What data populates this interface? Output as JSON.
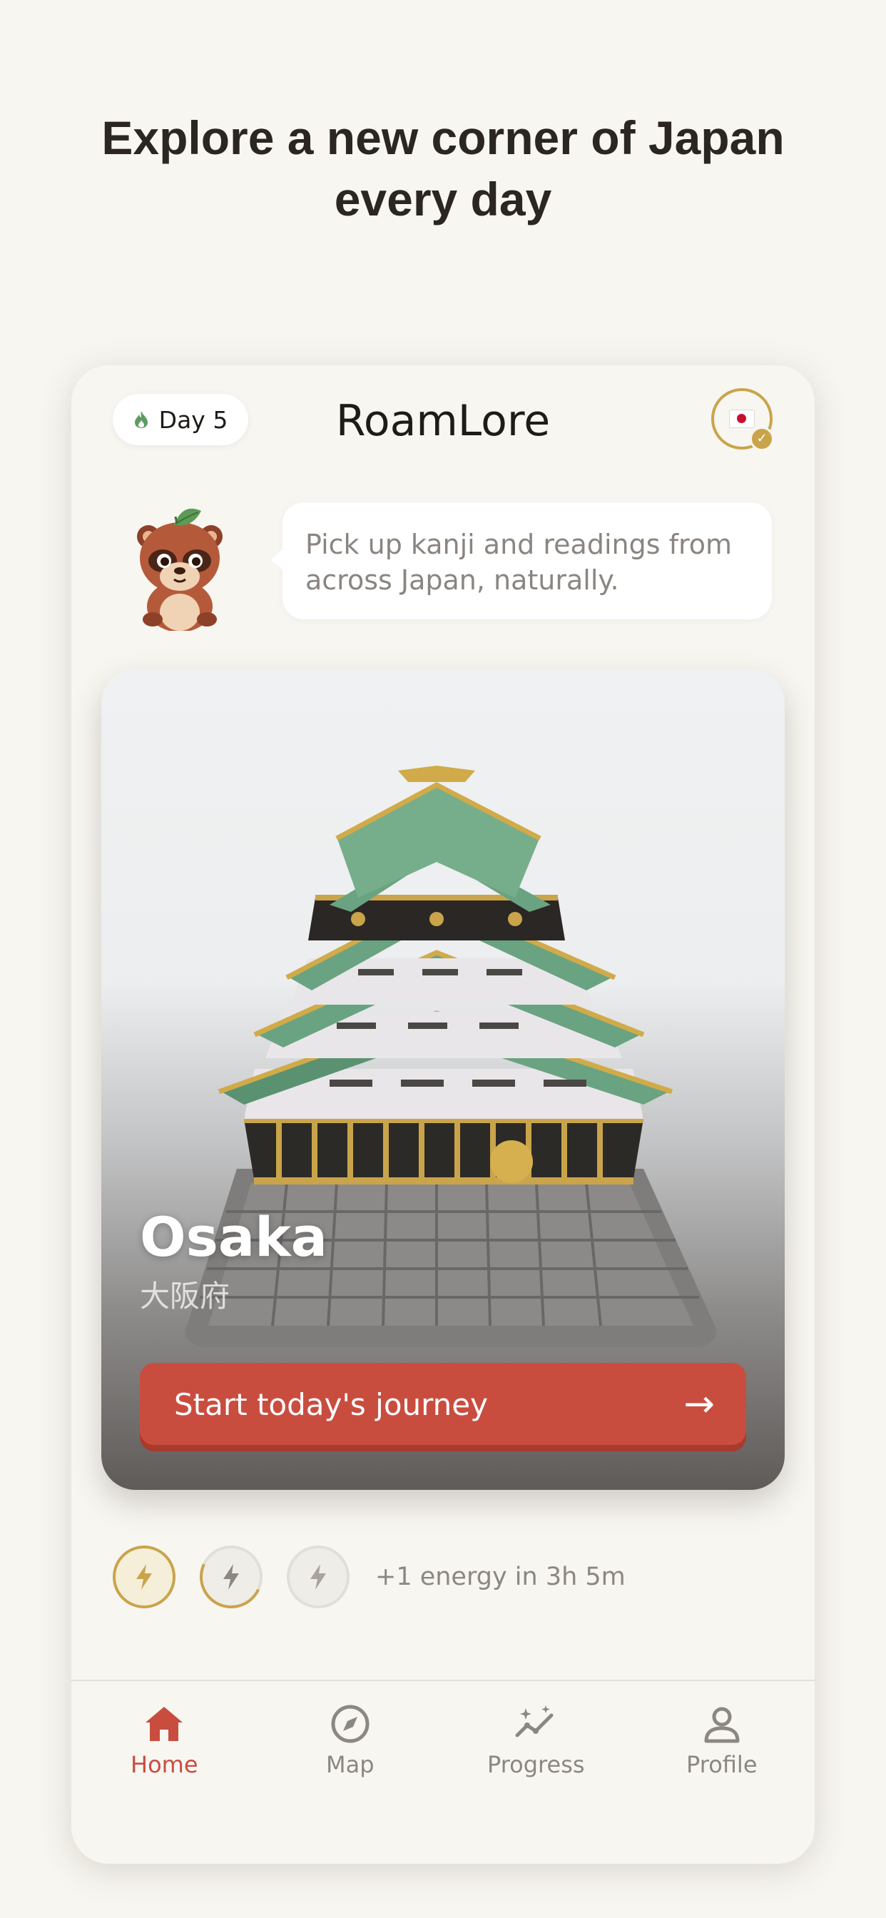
{
  "headline": {
    "line1": "Explore a new corner of Japan",
    "line2": "every day"
  },
  "app": {
    "title": "RoamLore",
    "day_label": "Day 5",
    "streak_icon": "flame-icon",
    "avatar_flag": "japan-flag-icon"
  },
  "mascot": {
    "icon": "tanuki-mascot",
    "message": "Pick up kanji and readings from across Japan, naturally."
  },
  "destination": {
    "name": "Osaka",
    "kanji": "大阪府",
    "image": "osaka-castle-illustration",
    "cta_label": "Start today's journey",
    "cta_arrow": "→"
  },
  "energy": {
    "icon": "lightning-icon",
    "levels": [
      1,
      0.6,
      0
    ],
    "refill_text": "+1 energy in 3h 5m"
  },
  "nav": {
    "items": [
      {
        "label": "Home",
        "icon": "home-icon",
        "active": true
      },
      {
        "label": "Map",
        "icon": "compass-icon",
        "active": false
      },
      {
        "label": "Progress",
        "icon": "progress-chart-icon",
        "active": false
      },
      {
        "label": "Profile",
        "icon": "user-icon",
        "active": false
      }
    ]
  },
  "colors": {
    "background": "#f8f6f1",
    "accent_red": "#c94d3f",
    "accent_gold": "#c9a44a",
    "text_dark": "#1e1b18",
    "text_muted": "#8c8781"
  }
}
